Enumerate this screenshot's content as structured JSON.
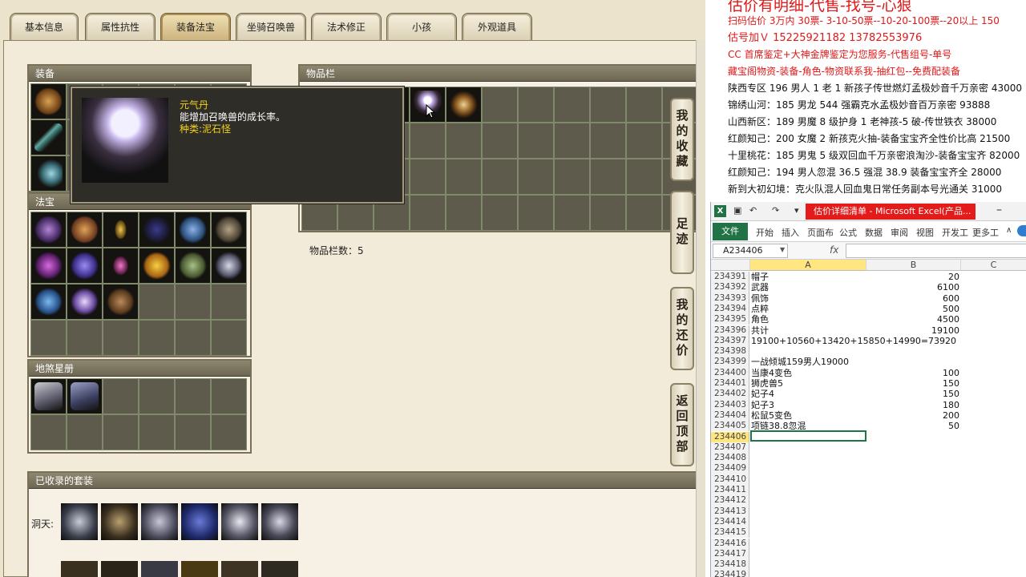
{
  "game": {
    "tabs": [
      "基本信息",
      "属性抗性",
      "装备法宝",
      "坐骑召唤兽",
      "法术修正",
      "小孩",
      "外观道具"
    ],
    "active_tab": "装备法宝",
    "equip_title": "装备",
    "fabao_title": "法宝",
    "star_title": "地煞星册",
    "inventory_title": "物品栏",
    "inventory_count": "物品栏数：5",
    "collection_title": "已收录的套装",
    "collection_row_label": "洞天:",
    "tooltip": {
      "name": "元气丹",
      "desc": "能增加召唤兽的成长率。",
      "kind": "种类:泥石怪"
    },
    "side_buttons": [
      "我的收藏",
      "足迹",
      "我的还价",
      "返回顶部"
    ]
  },
  "notes": {
    "headline": "估价有明细-代售-找号-心狠",
    "lines": [
      {
        "text": "扫码估价 3万内 30票- 3-10-50票--10-20-100票--20以上 150",
        "style": "red"
      },
      {
        "text": "估号加Ｖ 15225921182   13782553976",
        "style": "red14"
      },
      {
        "text": "CC 首席鉴定+大神金牌鉴定为您服务-代售组号-单号",
        "style": "red"
      },
      {
        "text": "藏宝阁物资-装备-角色-物资联系我-抽红包--免费配装备",
        "style": "red"
      },
      {
        "text": "陕西专区 196 男人 1 老 1 新孩子传世燃灯孟极妙音千万亲密 43000",
        "style": "blk"
      },
      {
        "text": "锦绣山河：185 男龙 544 强霸克水孟极妙音百万亲密 93888",
        "style": "blk"
      },
      {
        "text": "山西新区：189 男魔 8 级护身 1 老神孩-5 破-传世铁衣 38000",
        "style": "blk"
      },
      {
        "text": "红颜知己：200 女魔 2 新孩克火抽-装备宝宝齐全性价比高 21500",
        "style": "blk"
      },
      {
        "text": "十里桃花：185 男鬼 5 级双回血千万亲密浪淘沙-装备宝宝齐 82000",
        "style": "blk"
      },
      {
        "text": "红颜知己：194 男人忽混 36.5 强混 38.9 装备宝宝齐全 28000",
        "style": "blk"
      },
      {
        "text": "新到大初幻境：克火队混人回血鬼日常任务副本号光通关 31000",
        "style": "blk"
      }
    ]
  },
  "excel": {
    "title": "估价详细清单 - Microsoft Excel(产品...",
    "ribbon_tabs": [
      "开始",
      "插入",
      "页面布",
      "公式",
      "数据",
      "审阅",
      "视图",
      "开发工",
      "更多工"
    ],
    "file_tab": "文件",
    "name_box": "A234406",
    "fx": "fx",
    "columns": [
      "A",
      "B",
      "C"
    ],
    "rows": [
      {
        "n": "234391",
        "a": "帽子",
        "b": "20"
      },
      {
        "n": "234392",
        "a": "武器",
        "b": "6100"
      },
      {
        "n": "234393",
        "a": "佩饰",
        "b": "600"
      },
      {
        "n": "234394",
        "a": "点粹",
        "b": "500"
      },
      {
        "n": "234395",
        "a": "角色",
        "b": "4500"
      },
      {
        "n": "234396",
        "a": "共计",
        "b": "19100"
      },
      {
        "n": "234397",
        "a": "19100+10560+13420+15850+14990=73920",
        "b": ""
      },
      {
        "n": "234398",
        "a": "",
        "b": ""
      },
      {
        "n": "234399",
        "a": "一战倾城159男人19000",
        "b": ""
      },
      {
        "n": "234400",
        "a": "当康4变色",
        "b": "100"
      },
      {
        "n": "234401",
        "a": "狮虎兽5",
        "b": "150"
      },
      {
        "n": "234402",
        "a": "妃子4",
        "b": "150"
      },
      {
        "n": "234403",
        "a": "妃子3",
        "b": "180"
      },
      {
        "n": "234404",
        "a": "松鼠5变色",
        "b": "200"
      },
      {
        "n": "234405",
        "a": "项链38.8忽混",
        "b": "50"
      },
      {
        "n": "234406",
        "a": "",
        "b": ""
      },
      {
        "n": "234407",
        "a": "",
        "b": ""
      },
      {
        "n": "234408",
        "a": "",
        "b": ""
      },
      {
        "n": "234409",
        "a": "",
        "b": ""
      },
      {
        "n": "234410",
        "a": "",
        "b": ""
      },
      {
        "n": "234411",
        "a": "",
        "b": ""
      },
      {
        "n": "234412",
        "a": "",
        "b": ""
      },
      {
        "n": "234413",
        "a": "",
        "b": ""
      },
      {
        "n": "234414",
        "a": "",
        "b": ""
      },
      {
        "n": "234415",
        "a": "",
        "b": ""
      },
      {
        "n": "234416",
        "a": "",
        "b": ""
      },
      {
        "n": "234417",
        "a": "",
        "b": ""
      },
      {
        "n": "234418",
        "a": "",
        "b": ""
      },
      {
        "n": "234419",
        "a": "",
        "b": ""
      }
    ],
    "selected_row": "234406"
  },
  "colors": {
    "accent_red": "#e01818",
    "excel_green": "#217346",
    "tooltip_gold": "#f6d21c"
  }
}
